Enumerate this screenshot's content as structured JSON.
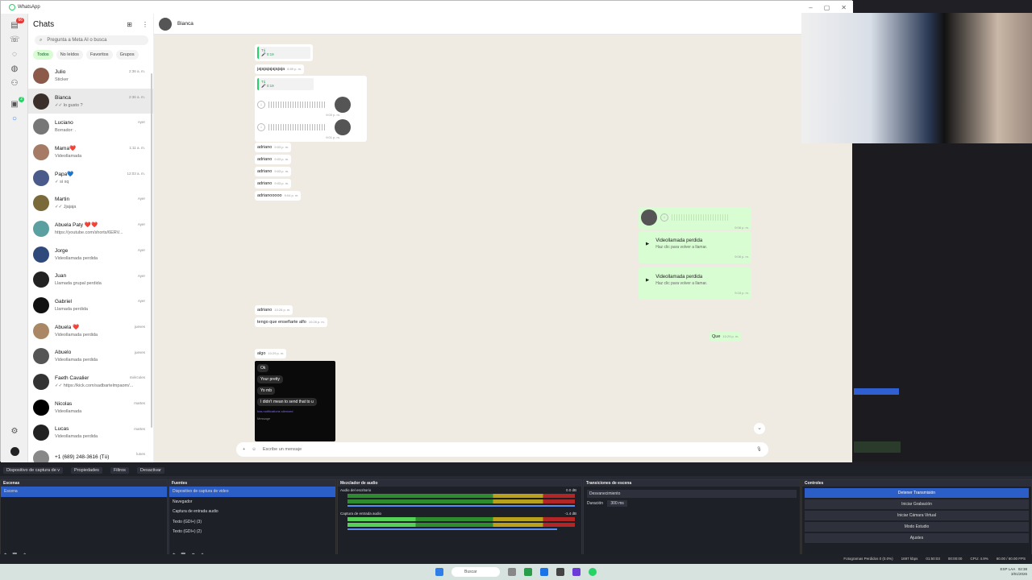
{
  "window": {
    "title": "WhatsApp"
  },
  "sidebar": {
    "title": "Chats",
    "search_placeholder": "Pregunta a Meta AI o busca",
    "badge_chats": "66",
    "badge_status": "2",
    "filters": [
      "Todos",
      "No leídos",
      "Favoritos",
      "Grupos"
    ],
    "chats": [
      {
        "name": "Julio",
        "preview": "Sticker",
        "time": "2:36 a. m.",
        "icon": "sticker-icon"
      },
      {
        "name": "Bianca",
        "preview": "✓✓ lo gusto ?",
        "time": "2:36 a. m.",
        "selected": true
      },
      {
        "name": "Luciano",
        "preview": "Borrador: .",
        "time": "Ayer"
      },
      {
        "name": "Mama❤️",
        "preview": "Videollamada",
        "time": "1:11 a. m."
      },
      {
        "name": "Papa💙",
        "preview": "✓ si xq",
        "time": "12:03 a. m."
      },
      {
        "name": "Martin",
        "preview": "✓✓ Jjajaja",
        "time": "Ayer"
      },
      {
        "name": "Abuela Paty ❤️❤️",
        "preview": "https://youtube.com/shorts/6ERV...",
        "time": "Ayer"
      },
      {
        "name": "Jorge",
        "preview": "Videollamada perdida",
        "time": "Ayer"
      },
      {
        "name": "Juan",
        "preview": "Llamada grupal perdida",
        "time": "Ayer"
      },
      {
        "name": "Gabriel",
        "preview": "Llamada perdida",
        "time": "Ayer"
      },
      {
        "name": "Abuela ❤️",
        "preview": "Videollamada perdida",
        "time": "jueves"
      },
      {
        "name": "Abuelo",
        "preview": "Videollamada perdida",
        "time": "jueves"
      },
      {
        "name": "Faeth Cavalier",
        "preview": "✓✓ https://kick.com/sadbartelmpaom/...",
        "time": "miércoles"
      },
      {
        "name": "Nicolas",
        "preview": "Videollamada",
        "time": "martes"
      },
      {
        "name": "Lucas",
        "preview": "Videollamada perdida",
        "time": "martes"
      },
      {
        "name": "+1 (689) 248-3616 (Tú)",
        "preview": "",
        "time": "lunes"
      }
    ]
  },
  "chat": {
    "name": "Bianca",
    "compose_placeholder": "Escribe un mensaje",
    "quote_author": "Tú",
    "quote_dur": "0:19",
    "m1": "jajajajajajajaja",
    "m1t": "8:59 p. m.",
    "v1t": "9:00 p. m.",
    "v2t": "9:01 p. m.",
    "adriano": [
      "adriano",
      "adriano",
      "adriano",
      "adriano",
      "adrianooooo"
    ],
    "adriano_t": [
      "9:03 p. m.",
      "9:03 p. m.",
      "9:03 p. m.",
      "9:03 p. m.",
      "9:04 p. m."
    ],
    "out_voice_t": "9:08 p. m.",
    "missed_title": "Videollamada perdida",
    "missed_sub": "Haz clic para volver a llamar.",
    "missed_t1": "9:08 p. m.",
    "missed_t2": "9:18 p. m.",
    "m_adr2": "adriano",
    "m_adr2_t": "10:28 p. m.",
    "m_teach": "tengo que enseñarte alfo",
    "m_teach_t": "10:28 p. m.",
    "m_que": "Que",
    "m_que_t": "10:29 p. m.",
    "m_algo": "algo",
    "m_algo_t": "10:29 p. m.",
    "shot": {
      "b1": "Ok",
      "b2": "Your pretty",
      "b3": "Yo mb",
      "b4": "I didn't mean to send that to u",
      "b5": "has notifications silenced",
      "b6": "Message"
    }
  },
  "obs": {
    "toolbar": [
      "Dispositivo de captura de v",
      "Propiedades",
      "Filtros",
      "Desactivar"
    ],
    "scenes_title": "Escenas",
    "scenes": [
      "Escena"
    ],
    "sources_title": "Fuentes",
    "sources": [
      "Dispositivo de captura de video",
      "Navegador",
      "Captura de entrada audio",
      "Texto (GDI+) (3)",
      "Texto (GDI+) (2)"
    ],
    "mixer_title": "Mezclador de audio",
    "mix1": "Audio del escritorio",
    "mix1_db": "0.0 dB",
    "mix2": "Captura de entrada audio",
    "mix2_db": "-1.4 dB",
    "trans_title": "Transiciones de escena",
    "trans": "Desvanecimiento",
    "dur_label": "Duración",
    "dur": "300 ms",
    "controls_title": "Controles",
    "controls": [
      "Detener Transmisión",
      "Iniciar Grabación",
      "Iniciar Cámara Virtual",
      "Modo Estudio",
      "Ajustes"
    ],
    "status": [
      "Fotogramas Perdidos 0 (0.0%)",
      "1697 kbps",
      "01:50:03",
      "00:00:00",
      "CPU: 4.9%",
      "60.00 / 60.00 FPS"
    ]
  },
  "taskbar": {
    "search": "Buscar",
    "lang": "ESP LAA",
    "time": "02:38",
    "date": "3/01/2026"
  }
}
